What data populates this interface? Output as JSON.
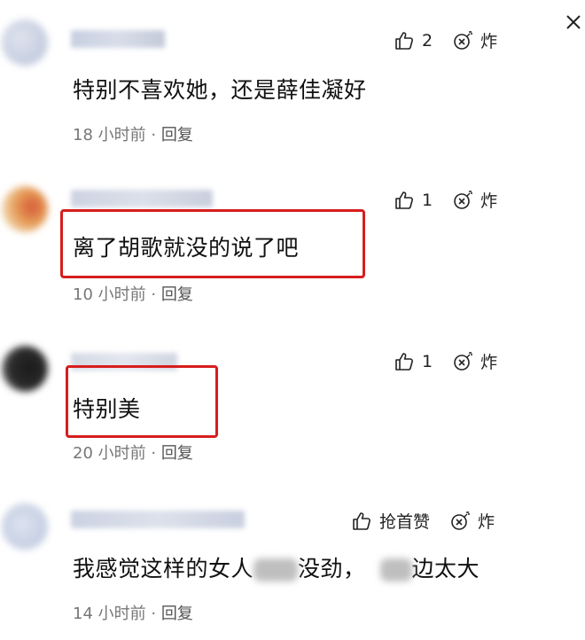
{
  "close_icon": "close-icon",
  "comments": [
    {
      "likes": "2",
      "bomb_label": "炸",
      "text": "特别不喜欢她，还是薛佳凝好",
      "time": "18 小时前",
      "sep": " · ",
      "reply": "回复"
    },
    {
      "likes": "1",
      "bomb_label": "炸",
      "text": "离了胡歌就没的说了吧",
      "time": "10 小时前",
      "sep": " · ",
      "reply": "回复"
    },
    {
      "likes": "1",
      "bomb_label": "炸",
      "text": "特别美",
      "time": "20 小时前",
      "sep": " · ",
      "reply": "回复"
    },
    {
      "likes": "抢首赞",
      "bomb_label": "炸",
      "text_a": "我感觉这样的女人",
      "text_b": "没劲，",
      "text_c": "边太大",
      "time": "14 小时前",
      "sep": " · ",
      "reply": "回复"
    }
  ]
}
